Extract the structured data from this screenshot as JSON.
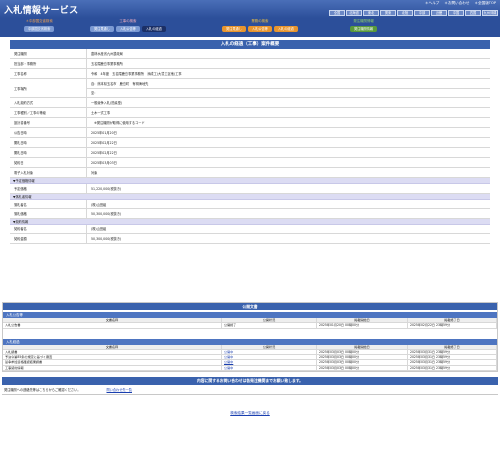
{
  "header": {
    "title": "入札情報サービス",
    "top_links": [
      "＊ヘルプ",
      "＊お問い合わせ",
      "＊全国版TOP"
    ],
    "regions": [
      "全国",
      "北海道",
      "東北",
      "関東",
      "北陸",
      "中部",
      "近畿",
      "中国",
      "四国",
      "九州沖縄"
    ]
  },
  "tabs": {
    "group1": {
      "label": "＊中部国交省検索",
      "buttons": [
        "中部国交省検索"
      ]
    },
    "group2": {
      "label": "工事の検索",
      "buttons": [
        "発注見通し",
        "入札公告等",
        "入札の経過"
      ]
    },
    "group3": {
      "label": "業務の検索",
      "buttons": [
        "発注見通し",
        "入札公告等",
        "入札の経過"
      ]
    },
    "group4": {
      "label": "発注機関情報",
      "buttons": [
        "発注機関情報"
      ]
    }
  },
  "main": {
    "heading": "入札の経過（工事）案件概要",
    "rows": [
      {
        "label": "発注機関",
        "value": "農林水産省九州農政局"
      },
      {
        "label": "担当部・事務所",
        "value": "五名隈鹿島事業事務所"
      },
      {
        "label": "工事名称",
        "value": "令和　4年度　五名隈鹿島事業事務所　添成工(大豊工区他)工事"
      },
      {
        "label": "工事場所",
        "values": [
          "自：熊本県玉名市　鹿島町　有明海地先",
          "至："
        ]
      },
      {
        "label": "入札契約方式",
        "value": "一般競争入札(簡素型)"
      },
      {
        "label": "工事種別／工事の等級",
        "value": "土木一式工事"
      },
      {
        "label": "設計書番号",
        "value": "　※発注機関が取得に使用するコード"
      },
      {
        "label": "公告日時",
        "value": "2025年01月20日"
      },
      {
        "label": "開札日時",
        "value": "2025年02月22日"
      },
      {
        "label": "開札日時",
        "value": "2025年02月22日"
      },
      {
        "label": "契約日",
        "value": "2025年03月03日"
      },
      {
        "label": "電子入札対象",
        "value": "対象"
      }
    ],
    "sections": {
      "estimate": {
        "title": "▼予定価格情報",
        "rows": [
          {
            "label": "予定価格",
            "value": "51,220,000(税抜き)"
          }
        ]
      },
      "winner": {
        "title": "▼落札者情報",
        "rows": [
          {
            "label": "落札者名",
            "value": "(株)山田組"
          },
          {
            "label": "落札価格",
            "value": "50,300,000(税抜き)"
          }
        ]
      },
      "contract": {
        "title": "▼契約情報",
        "rows": [
          {
            "label": "契約者名",
            "value": "(株)山田組"
          },
          {
            "label": "契約金額",
            "value": "50,300,000(税抜き)"
          }
        ]
      }
    }
  },
  "announcements": {
    "heading": "公開文書",
    "notice": {
      "title": "入札公告等",
      "columns": [
        "文書名称",
        "公開状況",
        "掲載開始日",
        "掲載終了日"
      ],
      "rows": [
        [
          "入札公告書",
          "公開終了",
          "2025年01月20日 00時00分",
          "2025年02月22日 23時59分"
        ]
      ]
    },
    "progress": {
      "title": "入札経過",
      "columns": [
        "文書名称",
        "公開状況",
        "掲載開始日",
        "掲載終了日"
      ],
      "rows": [
        [
          "入札調書",
          "公開中",
          "2025年03月03日 00時00分",
          "2025年03月31日 23時59分"
        ],
        [
          "予決令第85条の規定に基づく審査",
          "公開中",
          "2025年03月03日 00時00分",
          "2025年03月31日 23時59分"
        ],
        [
          "競争参加資格確認結果調書",
          "公開中",
          "2025年03月03日 00時00分",
          "2025年03月31日 23時59分"
        ],
        [
          "工事契約情報",
          "公開中",
          "2025年03月03日 00時00分",
          "2025年03月31日 23時59分"
        ]
      ]
    }
  },
  "contact": {
    "heading": "内容に関するお問い合わせは各発注機関までお願い致します。",
    "text": "発注機関への連絡先等はこちらからご確認ください。",
    "link": "問い合わせ先一覧"
  },
  "back_link": "検索結果一覧画面に戻る"
}
